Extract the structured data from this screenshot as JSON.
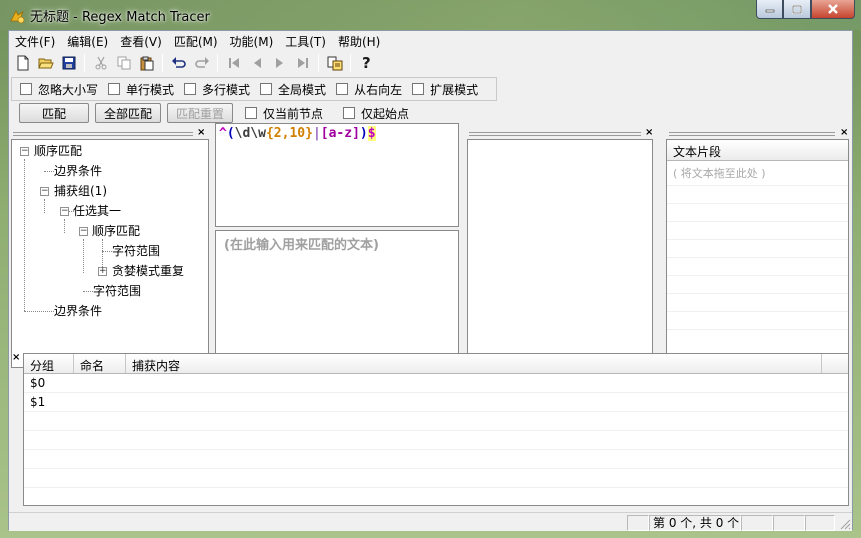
{
  "window": {
    "title": "无标题 - Regex Match Tracer"
  },
  "menu": [
    "文件(F)",
    "编辑(E)",
    "查看(V)",
    "匹配(M)",
    "功能(M)",
    "工具(T)",
    "帮助(H)"
  ],
  "options": [
    "忽略大小写",
    "单行模式",
    "多行模式",
    "全局模式",
    "从右向左",
    "扩展模式"
  ],
  "actions": {
    "match": "匹配",
    "match_all": "全部匹配",
    "rematch": "匹配重置",
    "current_node": "仅当前节点",
    "start_point": "仅起始点"
  },
  "tree": {
    "n0": "顺序匹配",
    "n1": "边界条件",
    "n2": "捕获组(1)",
    "n3": "任选其一",
    "n4": "顺序匹配",
    "n5": "字符范围",
    "n6": "贪婪模式重复",
    "n7": "字符范围",
    "n8": "边界条件"
  },
  "regex": {
    "p1": "^",
    "p2": "(",
    "p3": "\\d\\w",
    "p4": "{2,10}",
    "p5": "|",
    "p6": "[a-z]",
    "p7": ")",
    "p8": "$"
  },
  "text_input_placeholder": "(在此输入用来匹配的文本)",
  "snippets": {
    "header": "文本片段",
    "hint": "( 将文本拖至此处 )"
  },
  "groups": {
    "columns": [
      "分组",
      "命名",
      "捕获内容"
    ],
    "rows": [
      {
        "group": "$0"
      },
      {
        "group": "$1"
      }
    ]
  },
  "status": {
    "count": "第 0 个, 共 0 个"
  }
}
